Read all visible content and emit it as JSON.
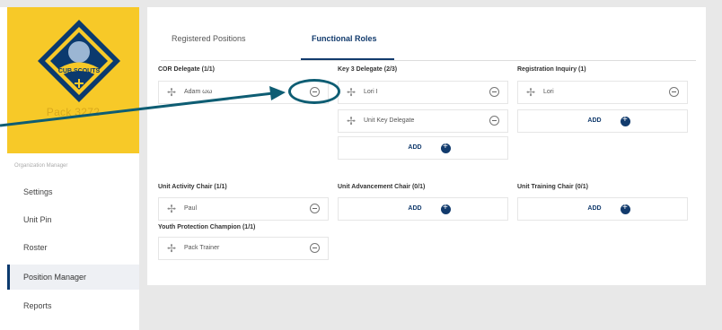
{
  "sidebar": {
    "pack_name": "Pack 3272",
    "org_label": "Organization Manager",
    "items": [
      {
        "label": "Settings"
      },
      {
        "label": "Unit Pin"
      },
      {
        "label": "Roster"
      },
      {
        "label": "Position Manager"
      },
      {
        "label": "Reports"
      }
    ]
  },
  "tabs": [
    {
      "label": "Registered Positions"
    },
    {
      "label": "Functional Roles"
    }
  ],
  "positions": {
    "cor_delegate": {
      "title": "COR Delegate (1/1)",
      "slots": [
        "Adam ωω"
      ]
    },
    "key3_delegate": {
      "title": "Key 3 Delegate (2/3)",
      "slots": [
        "Lori I",
        "Unit Key Delegate"
      ],
      "add": "ADD"
    },
    "registration_inquiry": {
      "title": "Registration Inquiry (1)",
      "slots": [
        "Lori"
      ],
      "add": "ADD"
    },
    "unit_activity_chair": {
      "title": "Unit Activity Chair (1/1)",
      "slots": [
        "Paul"
      ]
    },
    "unit_advancement_chair": {
      "title": "Unit Advancement Chair (0/1)",
      "add": "ADD"
    },
    "unit_training_chair": {
      "title": "Unit Training Chair (0/1)",
      "add": "ADD"
    },
    "youth_protection_champion": {
      "title": "Youth Protection Champion (1/1)",
      "slots": [
        "Pack Trainer"
      ]
    }
  },
  "colors": {
    "brand_yellow": "#f7c928",
    "navy": "#123b6d",
    "callout": "#0e5d73"
  }
}
